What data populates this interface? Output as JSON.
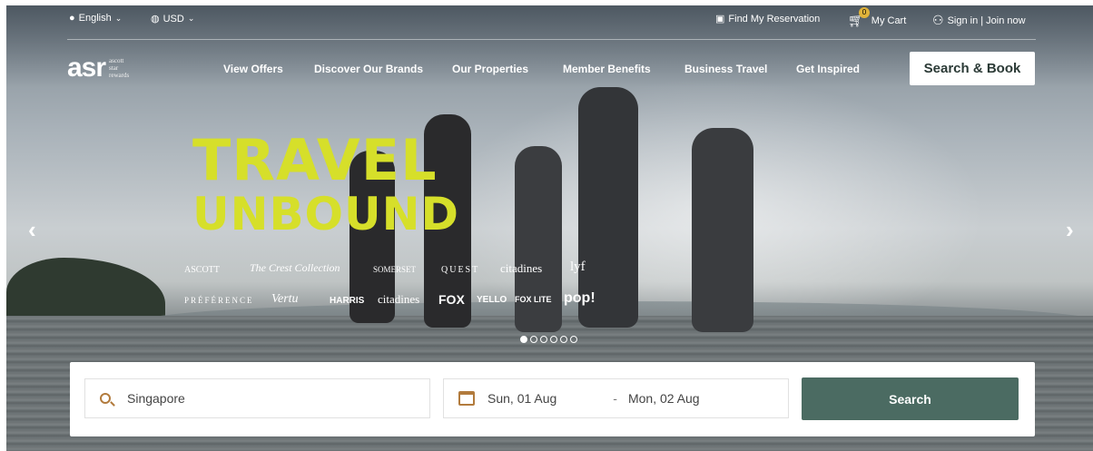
{
  "topbar": {
    "language": "English",
    "currency": "USD",
    "find_reservation": "Find My Reservation",
    "cart_label": "My Cart",
    "cart_count": "0",
    "account": "Sign in | Join now"
  },
  "logo": {
    "main": "asr",
    "line1": "ascott",
    "line2": "star",
    "line3": "rewards"
  },
  "nav": {
    "items": [
      {
        "label": "View Offers"
      },
      {
        "label": "Discover Our Brands"
      },
      {
        "label": "Our Properties"
      },
      {
        "label": "Member Benefits"
      },
      {
        "label": "Business Travel"
      },
      {
        "label": "Get Inspired"
      }
    ],
    "cta": "Search & Book"
  },
  "hero": {
    "headline_1": "TRAVEL",
    "headline_2": "UNBOUND",
    "brands_row1": [
      "ASCOTT",
      "The Crest Collection",
      "SOMERSET",
      "QUEST",
      "citadines",
      "lyf"
    ],
    "brands_row2": [
      "PRÉFÉRENCE",
      "Vertu",
      "HARRIS",
      "citadines",
      "FOX",
      "YELLO",
      "FOX LITE",
      "pop!"
    ],
    "slides_total": 6,
    "active_slide": 1
  },
  "search": {
    "destination": "Singapore",
    "check_in": "Sun, 01 Aug",
    "separator": "-",
    "check_out": "Mon, 02 Aug",
    "button": "Search"
  },
  "colors": {
    "headline": "#d6df2a",
    "search_button": "#4b6b62",
    "icon_accent": "#b27b3d"
  }
}
